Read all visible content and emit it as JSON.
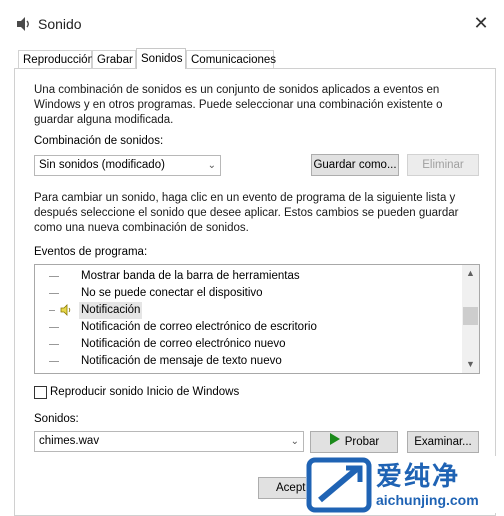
{
  "window": {
    "title": "Sonido",
    "close_glyph": "✕"
  },
  "tabs": [
    {
      "label": "Reproducción",
      "active": false
    },
    {
      "label": "Grabar",
      "active": false
    },
    {
      "label": "Sonidos",
      "active": true
    },
    {
      "label": "Comunicaciones",
      "active": false
    }
  ],
  "intro_text": "Una combinación de sonidos es un conjunto de sonidos aplicados a eventos en Windows y en otros programas. Puede seleccionar una combinación existente o guardar alguna modificada.",
  "scheme": {
    "label": "Combinación de sonidos:",
    "selected": "Sin sonidos (modificado)",
    "save_label": "Guardar como...",
    "delete_label": "Eliminar"
  },
  "instructions_text": "Para cambiar un sonido, haga clic en un evento de programa de la siguiente lista y después seleccione el sonido que desee aplicar. Estos cambios se pueden guardar como una nueva combinación de sonidos.",
  "events": {
    "label": "Eventos de programa:",
    "items": [
      {
        "label": "Mostrar banda de la barra de herramientas",
        "selected": false,
        "has_sound": false
      },
      {
        "label": "No se puede conectar el dispositivo",
        "selected": false,
        "has_sound": false
      },
      {
        "label": "Notificación",
        "selected": true,
        "has_sound": true
      },
      {
        "label": "Notificación de correo electrónico de escritorio",
        "selected": false,
        "has_sound": false
      },
      {
        "label": "Notificación de correo electrónico nuevo",
        "selected": false,
        "has_sound": false
      },
      {
        "label": "Notificación de mensaje de texto nuevo",
        "selected": false,
        "has_sound": false
      }
    ]
  },
  "startup": {
    "label": "Reproducir sonido Inicio de Windows",
    "checked": false
  },
  "sounds": {
    "label": "Sonidos:",
    "selected": "chimes.wav",
    "test_label": "Probar",
    "browse_label": "Examinar..."
  },
  "footer": {
    "ok_label": "Acept"
  },
  "watermark": {
    "brand_cn": "爱纯净",
    "url": "aichunjing.com"
  },
  "colors": {
    "play_icon": "#1b8a1b",
    "speaker_icon": "#c9b300",
    "watermark_blue": "#1f63b4"
  }
}
